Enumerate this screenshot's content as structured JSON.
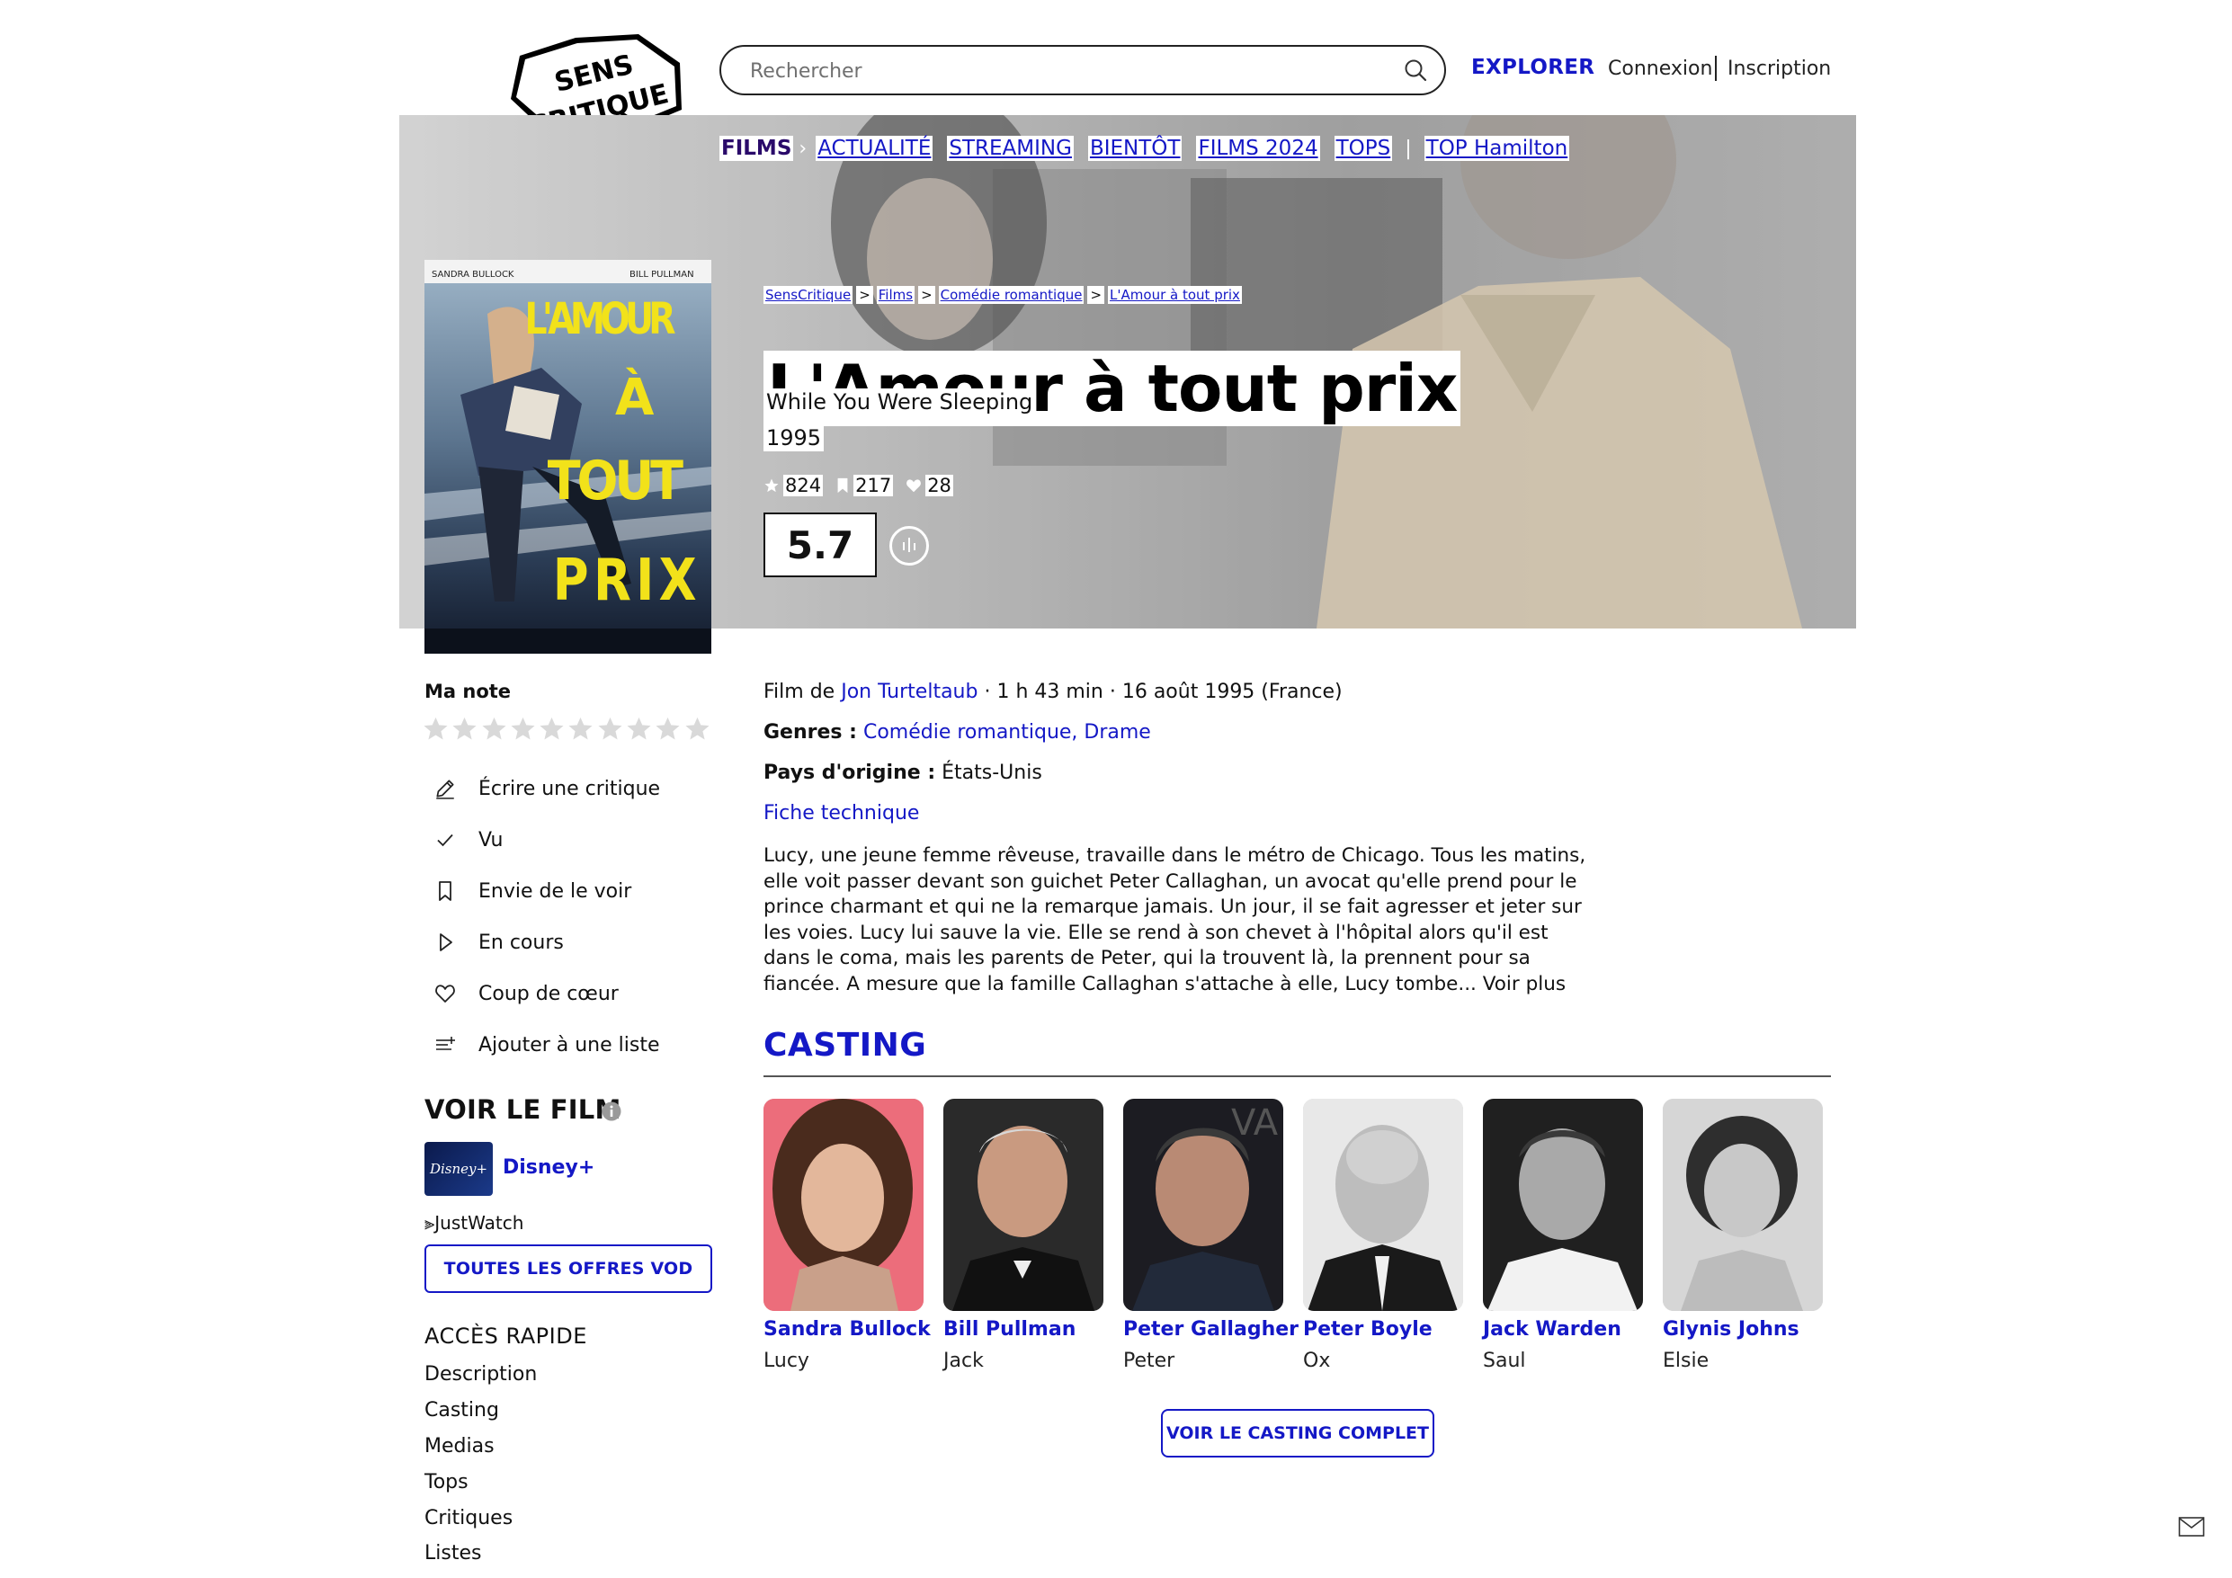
{
  "header": {
    "logo_text_top": "SENS",
    "logo_text_bottom": "CRITIQUE",
    "search_placeholder": "Rechercher",
    "explore": "EXPLORER",
    "login": "Connexion",
    "signup": "Inscription"
  },
  "subnav": {
    "active": "FILMS",
    "items": [
      "ACTUALITÉ",
      "STREAMING",
      "BIENTÔT",
      "FILMS 2024",
      "TOPS"
    ],
    "extra": "TOP Hamilton"
  },
  "poster": {
    "actor_left": "SANDRA BULLOCK",
    "actor_right": "BILL PULLMAN",
    "title_lines": [
      "L'AMOUR",
      "À",
      "TOUT",
      "PRIX"
    ]
  },
  "breadcrumb": [
    "SensCritique",
    "Films",
    "Comédie romantique",
    "L'Amour à tout prix"
  ],
  "breadcrumb_sep": ">",
  "movie": {
    "title": "L'Amour à tout prix",
    "original_title": "While You Were Sleeping",
    "year": "1995",
    "ratings_count": "824",
    "wishlist_count": "217",
    "favorites_count": "28",
    "score": "5.7",
    "director_prefix": "Film de",
    "director": "Jon Turteltaub",
    "details": " · 1 h 43 min · 16 août 1995 (France)",
    "genres_label": "Genres :",
    "genres": "Comédie romantique, Drame",
    "country_label": "Pays d'origine :",
    "country": "États-Unis",
    "tech_sheet": "Fiche technique",
    "synopsis": "Lucy, une jeune femme rêveuse, travaille dans le métro de Chicago. Tous les matins, elle voit passer devant son guichet Peter Callaghan, un avocat qu'elle prend pour le prince charmant et qui ne la remarque jamais. Un jour, il se fait agresser et jeter sur les voies. Lucy lui sauve la vie. Elle se rend à son chevet à l'hôpital alors qu'il est dans le coma, mais les parents de Peter, qui la trouvent là, la prennent pour sa fiancée. A mesure que la famille Callaghan s'attache à elle, Lucy tombe...",
    "read_more": "Voir plus"
  },
  "sidebar": {
    "my_rating": "Ma note",
    "star_count": 10,
    "actions": [
      {
        "label": "Écrire une critique",
        "icon": "pencil-icon"
      },
      {
        "label": "Vu",
        "icon": "check-icon"
      },
      {
        "label": "Envie de le voir",
        "icon": "bookmark-icon"
      },
      {
        "label": "En cours",
        "icon": "play-icon"
      },
      {
        "label": "Coup de cœur",
        "icon": "heart-icon"
      },
      {
        "label": "Ajouter à une liste",
        "icon": "list-add-icon"
      }
    ],
    "watch_title": "VOIR LE FILM",
    "provider_logo": "Disney+",
    "provider": "Disney+",
    "justwatch": "JustWatch",
    "vod_button": "TOUTES LES OFFRES VOD",
    "quick_access_title": "ACCÈS RAPIDE",
    "quick_links": [
      "Description",
      "Casting",
      "Medias",
      "Tops",
      "Critiques",
      "Listes"
    ]
  },
  "casting": {
    "title": "CASTING",
    "actors": [
      {
        "name": "Sandra Bullock",
        "role": "Lucy"
      },
      {
        "name": "Bill Pullman",
        "role": "Jack"
      },
      {
        "name": "Peter Gallagher",
        "role": "Peter"
      },
      {
        "name": "Peter Boyle",
        "role": "Ox"
      },
      {
        "name": "Jack Warden",
        "role": "Saul"
      },
      {
        "name": "Glynis Johns",
        "role": "Elsie"
      }
    ],
    "full_button": "VOIR LE CASTING COMPLET"
  },
  "colors": {
    "accent": "#1418c6",
    "poster_title": "#f2e21a"
  }
}
